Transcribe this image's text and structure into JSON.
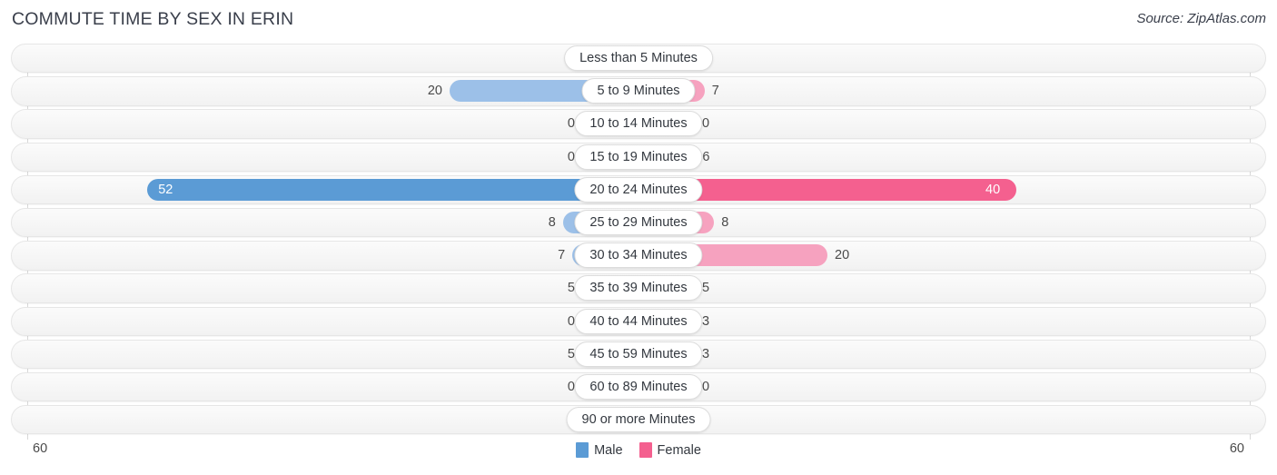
{
  "header": {
    "title": "COMMUTE TIME BY SEX IN ERIN",
    "source": "Source: ZipAtlas.com"
  },
  "axis": {
    "left_label": "60",
    "right_label": "60",
    "max": 60
  },
  "legend": {
    "items": [
      {
        "label": "Male",
        "color": "#5b9bd5"
      },
      {
        "label": "Female",
        "color": "#f4608f"
      }
    ]
  },
  "colors": {
    "male_base": "#9cc0e8",
    "male_max": "#5b9bd5",
    "female_base": "#f6a2bf",
    "female_max": "#f4608f",
    "track_bg": "#f7f7f7",
    "gridline": "#d8d8d8",
    "text": "#4a4a4a"
  },
  "chart_data": {
    "type": "bar",
    "orientation": "horizontal-diverging",
    "title": "COMMUTE TIME BY SEX IN ERIN",
    "xlabel": "",
    "ylabel": "",
    "xlim": [
      60,
      60
    ],
    "grid": true,
    "legend_position": "bottom-center",
    "categories": [
      "Less than 5 Minutes",
      "5 to 9 Minutes",
      "10 to 14 Minutes",
      "15 to 19 Minutes",
      "20 to 24 Minutes",
      "25 to 29 Minutes",
      "30 to 34 Minutes",
      "35 to 39 Minutes",
      "40 to 44 Minutes",
      "45 to 59 Minutes",
      "60 to 89 Minutes",
      "90 or more Minutes"
    ],
    "series": [
      {
        "name": "Male",
        "values": [
          0,
          20,
          0,
          0,
          52,
          8,
          7,
          5,
          0,
          5,
          0,
          0
        ]
      },
      {
        "name": "Female",
        "values": [
          0,
          7,
          0,
          6,
          40,
          8,
          20,
          5,
          3,
          3,
          0,
          0
        ]
      }
    ]
  },
  "rows": [
    {
      "label": "Less than 5 Minutes",
      "male": "0",
      "female": "0"
    },
    {
      "label": "5 to 9 Minutes",
      "male": "20",
      "female": "7"
    },
    {
      "label": "10 to 14 Minutes",
      "male": "0",
      "female": "0"
    },
    {
      "label": "15 to 19 Minutes",
      "male": "0",
      "female": "6"
    },
    {
      "label": "20 to 24 Minutes",
      "male": "52",
      "female": "40"
    },
    {
      "label": "25 to 29 Minutes",
      "male": "8",
      "female": "8"
    },
    {
      "label": "30 to 34 Minutes",
      "male": "7",
      "female": "20"
    },
    {
      "label": "35 to 39 Minutes",
      "male": "5",
      "female": "5"
    },
    {
      "label": "40 to 44 Minutes",
      "male": "0",
      "female": "3"
    },
    {
      "label": "45 to 59 Minutes",
      "male": "5",
      "female": "3"
    },
    {
      "label": "60 to 89 Minutes",
      "male": "0",
      "female": "0"
    },
    {
      "label": "90 or more Minutes",
      "male": "0",
      "female": "0"
    }
  ]
}
